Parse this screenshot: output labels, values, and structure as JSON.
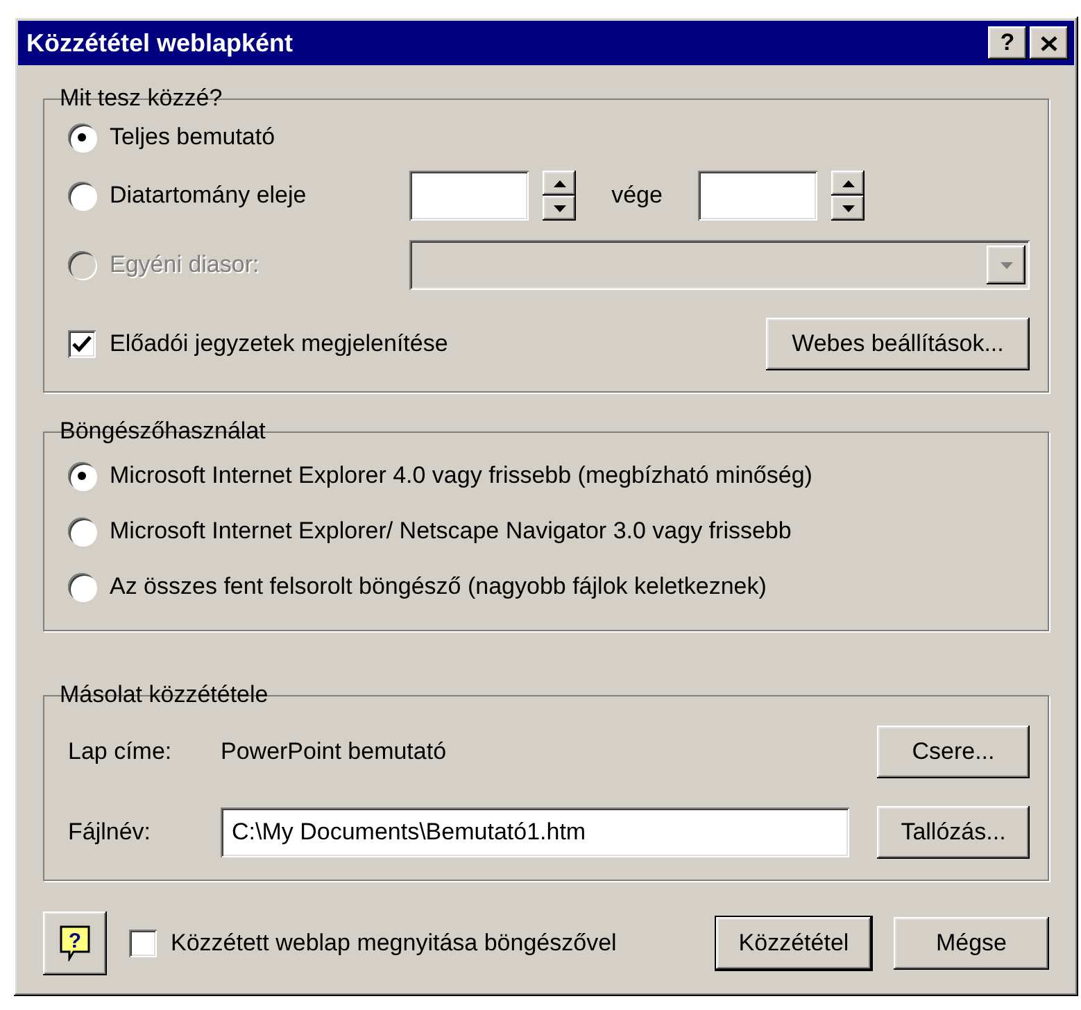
{
  "window": {
    "title": "Közzététel weblapként",
    "help_button": "?"
  },
  "publish_what": {
    "legend": "Mit tesz közzé?",
    "options": [
      {
        "kind": "full",
        "label": "Teljes bemutató",
        "selected": true,
        "disabled": false
      },
      {
        "kind": "range",
        "label": "Diatartomány eleje",
        "end_label": "vége",
        "selected": false,
        "disabled": false
      },
      {
        "kind": "custom",
        "label": "Egyéni diasor:",
        "selected": false,
        "disabled": true
      }
    ],
    "notes": {
      "label": "Előadói jegyzetek megjelenítése",
      "checked": true
    },
    "web_options_button": "Webes beállítások..."
  },
  "browser": {
    "legend": "Böngészőhasználat",
    "options": [
      {
        "label": "Microsoft Internet Explorer 4.0 vagy frissebb (megbízható minőség)",
        "selected": true
      },
      {
        "label": "Microsoft Internet Explorer/ Netscape Navigator 3.0 vagy frissebb",
        "selected": false
      },
      {
        "label": "Az összes fent felsorolt böngésző (nagyobb fájlok keletkeznek)",
        "selected": false
      }
    ]
  },
  "copy": {
    "legend": "Másolat közzététele",
    "page_title_label": "Lap címe:",
    "page_title": "PowerPoint bemutató",
    "change_button": "Csere...",
    "filename_label": "Fájlnév:",
    "filename": "C:\\My Documents\\Bemutató1.htm",
    "browse_button": "Tallózás..."
  },
  "footer": {
    "open_in_browser": {
      "label": "Közzétett weblap megnyitása böngészővel",
      "checked": false
    },
    "help_icon_text": "?",
    "publish_button": "Közzététel",
    "cancel_button": "Mégse"
  }
}
